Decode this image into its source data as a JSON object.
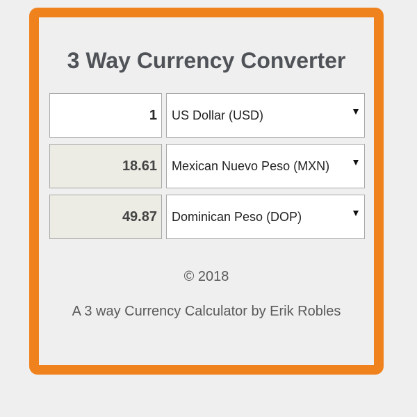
{
  "app": {
    "title": "3 Way Currency Converter"
  },
  "converter": {
    "rows": [
      {
        "amount": "1",
        "currency": "US Dollar (USD)",
        "editable": true
      },
      {
        "amount": "18.61",
        "currency": "Mexican Nuevo Peso (MXN)",
        "editable": false
      },
      {
        "amount": "49.87",
        "currency": "Dominican Peso (DOP)",
        "editable": false
      }
    ]
  },
  "footer": {
    "copyright": "© 2018",
    "byline": "A 3 way Currency Calculator by Erik Robles"
  },
  "colors": {
    "accent_border": "#f0821e",
    "background": "#efefef",
    "title_text": "#4f5358",
    "readonly_field": "#ecebe4"
  },
  "icons": {
    "dropdown": "caret-down-icon"
  }
}
